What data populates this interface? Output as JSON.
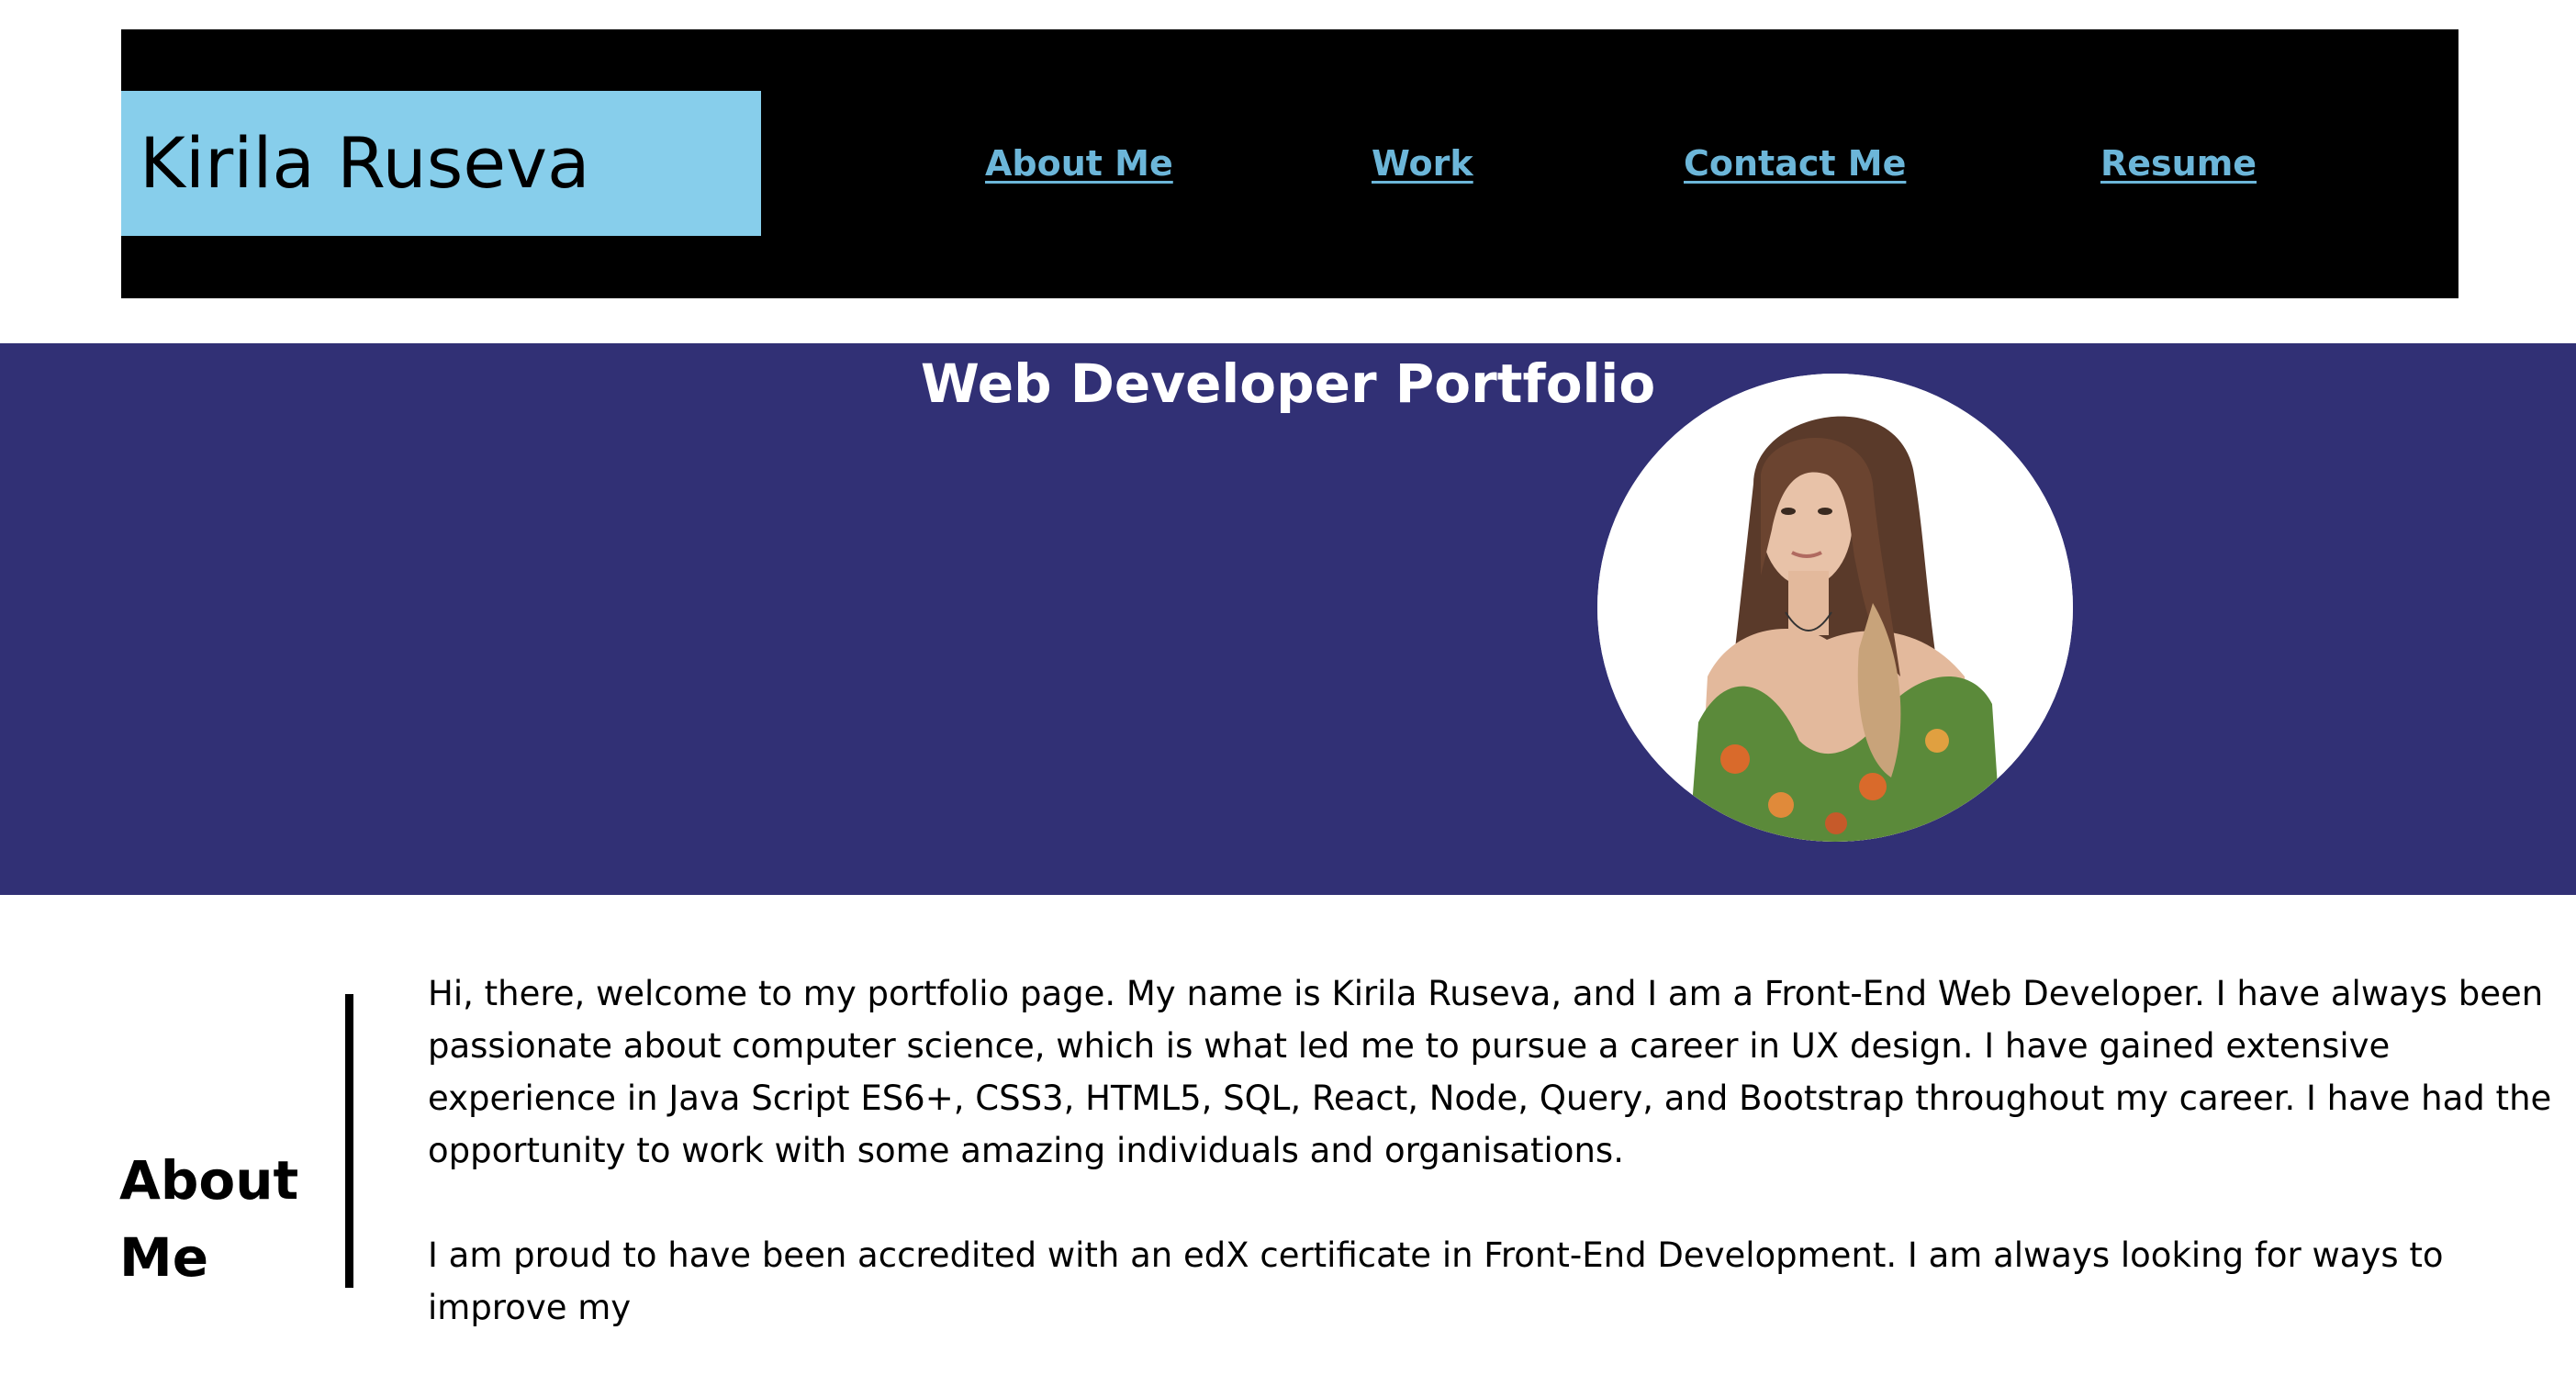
{
  "header": {
    "name": "Kirila Ruseva",
    "nav": [
      {
        "label": "About Me"
      },
      {
        "label": "Work"
      },
      {
        "label": "Contact Me"
      },
      {
        "label": "Resume"
      }
    ]
  },
  "hero": {
    "title": "Web Developer Portfolio",
    "photo_alt": "portrait-photo"
  },
  "about": {
    "heading": "About Me",
    "paragraphs": [
      "Hi, there, welcome to my portfolio page. My name is Kirila Ruseva, and I am a Front-End Web Developer. I have always been passionate about computer science, which is what led me to pursue a career in UX design. I have gained extensive experience in Java Script ES6+, CSS3, HTML5, SQL, React, Node, Query, and Bootstrap throughout my career. I have had the opportunity to work with some amazing individuals and organisations.",
      "I am proud to have been accredited with an edX certificate in Front-End Development. I am always looking for ways to improve my"
    ]
  },
  "colors": {
    "header_bg": "#000000",
    "logo_bg": "#87ceeb",
    "nav_link": "#6cb6d9",
    "hero_bg": "#313075"
  }
}
